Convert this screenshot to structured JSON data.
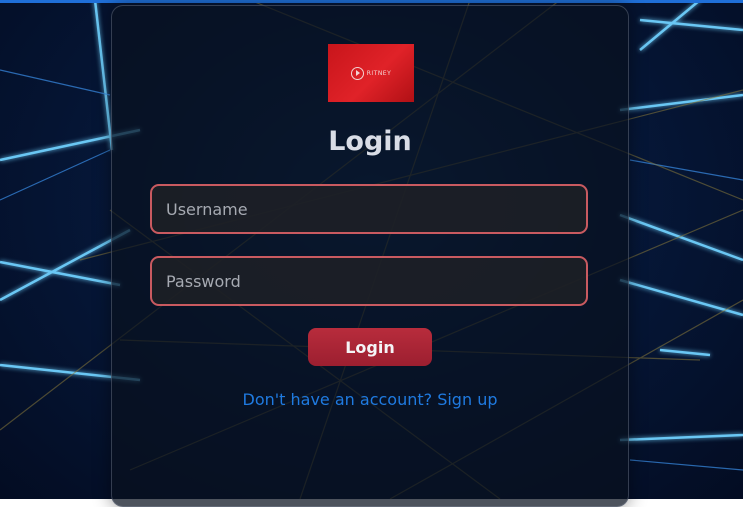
{
  "login": {
    "logo_icon": "play-circle-icon",
    "logo_text": "RITNEY",
    "title": "Login",
    "username_placeholder": "Username",
    "password_placeholder": "Password",
    "button_label": "Login",
    "signup_link": "Don't have an account? Sign up"
  },
  "colors": {
    "accent": "#c95a60",
    "button": "#a82536",
    "link": "#1f7ae0",
    "logo_red": "#d81b20"
  }
}
